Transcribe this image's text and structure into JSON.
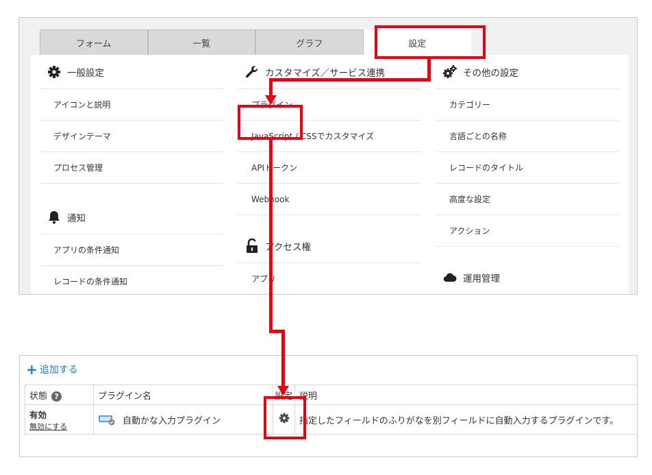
{
  "tabs": [
    "フォーム",
    "一覧",
    "グラフ",
    "設定"
  ],
  "general": {
    "title": "一般設定",
    "items": [
      "アイコンと説明",
      "デザインテーマ",
      "プロセス管理"
    ]
  },
  "notify": {
    "title": "通知",
    "items": [
      "アプリの条件通知",
      "レコードの条件通知"
    ]
  },
  "customize": {
    "title": "カスタマイズ／サービス連携",
    "items": [
      "プラグイン",
      "JavaScript / CSSでカスタマイズ",
      "APIトークン",
      "Webhook"
    ]
  },
  "access": {
    "title": "アクセス権",
    "items": [
      "アプリ"
    ]
  },
  "other": {
    "title": "その他の設定",
    "items": [
      "カテゴリー",
      "言語ごとの名称",
      "レコードのタイトル",
      "高度な設定",
      "アクション"
    ]
  },
  "ops": {
    "title": "運用管理"
  },
  "plugins": {
    "add_label": "追加する",
    "headers": {
      "status": "状態",
      "name": "プラグイン名",
      "settings": "設定",
      "description": "説明"
    },
    "rows": [
      {
        "status": "有効",
        "disable_link": "無効にする",
        "name": "自動かな入力プラグイン",
        "description": "指定したフィールドのふりがなを別フィールドに自動入力するプラグインです。"
      }
    ]
  },
  "colors": {
    "annotation": "#e60012",
    "link": "#1f7ac4"
  }
}
